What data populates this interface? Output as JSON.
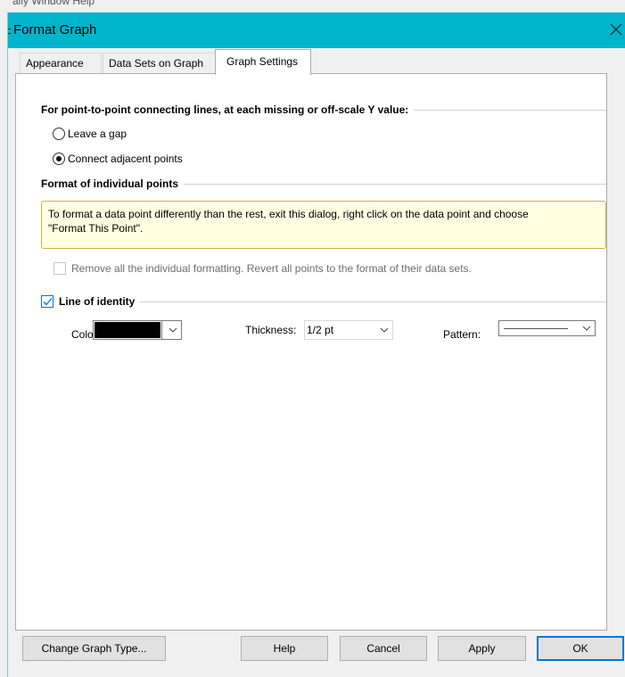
{
  "background_app": {
    "menu_text": "ally  Window   Help"
  },
  "dialog": {
    "title": "Format Graph",
    "close_glyph": "✕",
    "titlebar_color": "#00b4cc"
  },
  "tabs": [
    {
      "label": "Appearance",
      "active": false
    },
    {
      "label": "Data Sets on Graph",
      "active": false
    },
    {
      "label": "Graph Settings",
      "active": true
    }
  ],
  "connecting_lines": {
    "header": "For point-to-point connecting lines, at each missing or off-scale Y value:",
    "options": [
      {
        "label": "Leave a gap",
        "selected": false
      },
      {
        "label": "Connect adjacent points",
        "selected": true
      }
    ]
  },
  "individual_points": {
    "header": "Format of individual points",
    "info_line1": "To format a data point differently than the rest, exit this dialog, right click on the data point and choose",
    "info_line2": "\"Format This Point\".",
    "remove_label": "Remove all the individual formatting. Revert all points to the format of their data sets.",
    "remove_checked": false,
    "remove_enabled": false
  },
  "line_of_identity": {
    "label": "Line of identity",
    "checked": true,
    "color_label": "Color:",
    "color_value": "#000000",
    "thickness_label": "Thickness:",
    "thickness_value": "1/2 pt",
    "pattern_label": "Pattern:",
    "pattern_value": "solid"
  },
  "buttons": {
    "change_graph_type": "Change Graph Type...",
    "help": "Help",
    "cancel": "Cancel",
    "apply": "Apply",
    "ok": "OK"
  },
  "icons": {
    "close": "close-icon",
    "dropdown": "chevron-down-icon",
    "check": "checkmark-icon"
  }
}
